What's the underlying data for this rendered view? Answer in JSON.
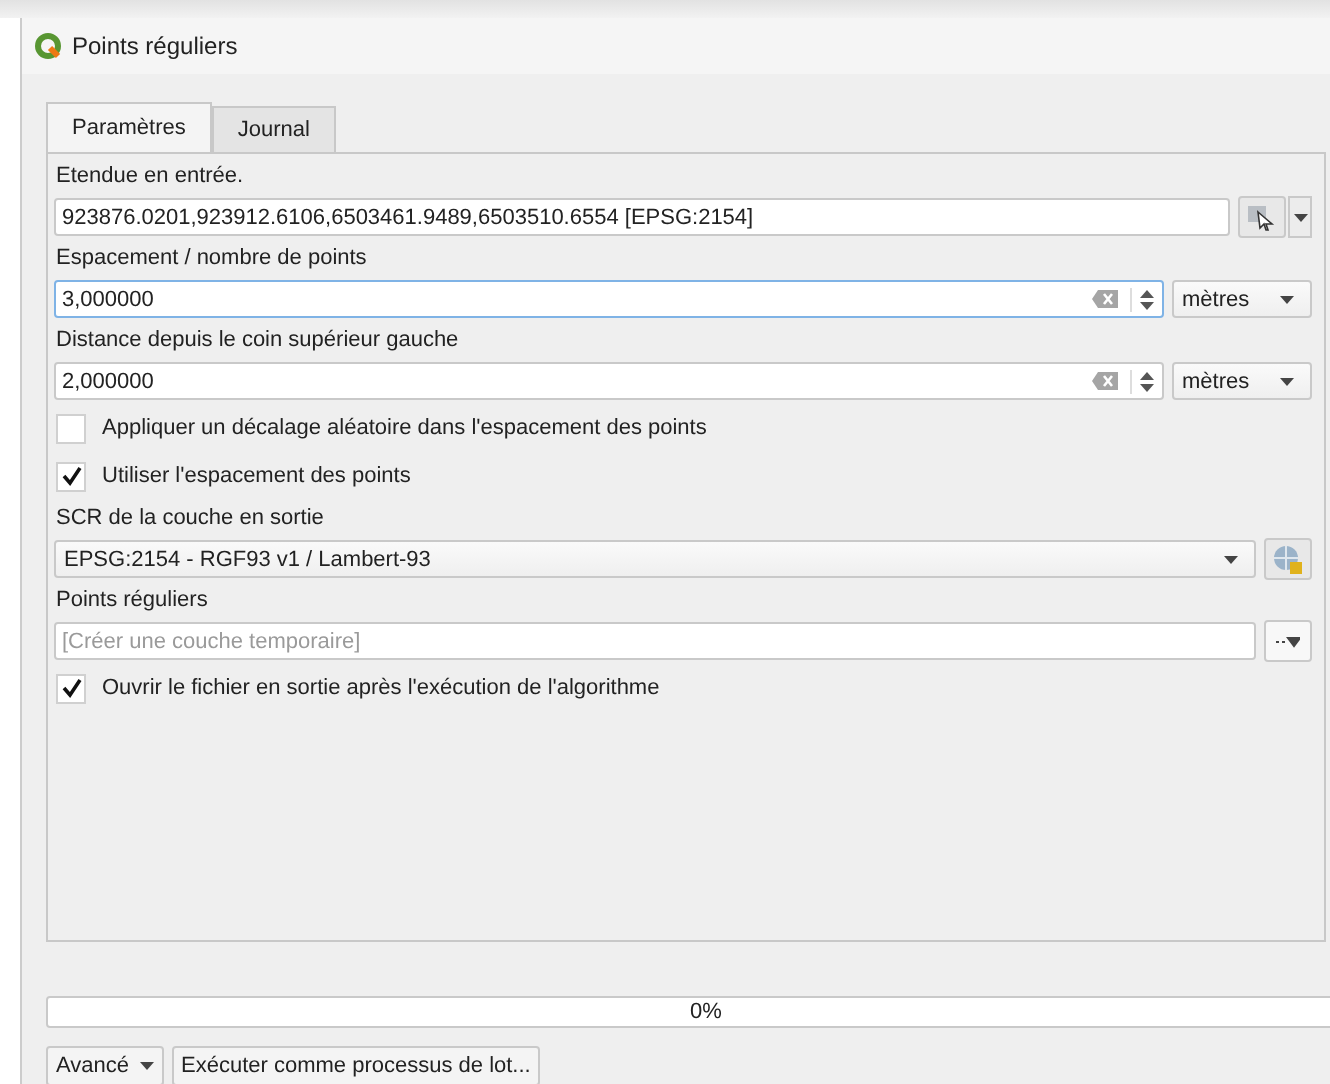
{
  "window": {
    "title": "Points réguliers"
  },
  "tabs": [
    {
      "label": "Paramètres",
      "selected": true
    },
    {
      "label": "Journal",
      "selected": false
    }
  ],
  "parameters": [
    {
      "kind": "extent",
      "label": "Etendue en entrée.",
      "value": "923876.0201,923912.6106,6503461.9489,6503510.6554 [EPSG:2154]"
    },
    {
      "kind": "distance",
      "label": "Espacement / nombre de points",
      "value": "3,000000",
      "focused": true,
      "unit": "mètres"
    },
    {
      "kind": "distance",
      "label": "Distance depuis le coin supérieur gauche",
      "value": "2,000000",
      "focused": false,
      "unit": "mètres"
    },
    {
      "kind": "checkbox",
      "label": "Appliquer un décalage aléatoire dans l'espacement des points",
      "checked": false
    },
    {
      "kind": "checkbox",
      "label": "Utiliser l'espacement des points",
      "checked": true
    },
    {
      "kind": "crs",
      "label": "SCR de la couche en sortie",
      "value": "EPSG:2154 - RGF93 v1 / Lambert-93"
    },
    {
      "kind": "output",
      "label": "Points réguliers",
      "placeholder": "[Créer une couche temporaire]"
    },
    {
      "kind": "checkbox",
      "label": "Ouvrir le fichier en sortie après l'exécution de l'algorithme",
      "checked": true
    }
  ],
  "progress": {
    "level": 0,
    "reading": "0%"
  },
  "buttons": [
    {
      "label": "Avancé",
      "dropdown": true
    },
    {
      "label": "Exécuter comme processus de lot...",
      "dropdown": false
    }
  ]
}
